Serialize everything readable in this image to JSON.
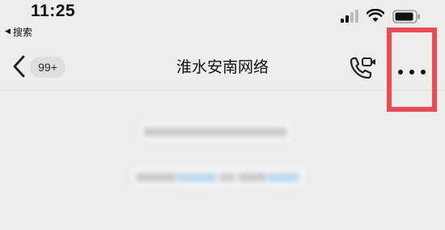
{
  "status_bar": {
    "time": "11:25",
    "back_app_label": "搜索",
    "icons": [
      "signal-icon",
      "wifi-icon",
      "battery-icon"
    ]
  },
  "nav_bar": {
    "unread_badge": "99+",
    "title": "淮水安南网络",
    "icons": [
      "back-chevron-icon",
      "video-call-icon",
      "more-dots-icon"
    ]
  },
  "colors": {
    "background": "#ededed",
    "highlight_box": "#ee4a52",
    "badge_bg": "#dedede",
    "blurred_link": "#b7d8f2"
  }
}
